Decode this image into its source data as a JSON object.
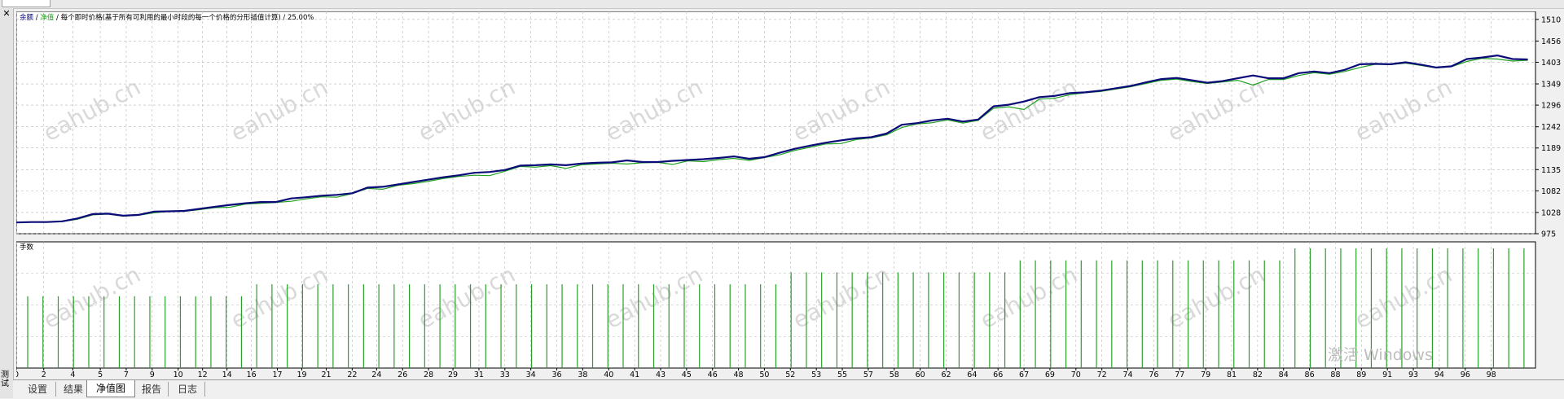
{
  "side": {
    "label": "测试"
  },
  "tabs": [
    {
      "label": "设置",
      "active": false
    },
    {
      "label": "结果",
      "active": false
    },
    {
      "label": "净值图",
      "active": true
    },
    {
      "label": "报告",
      "active": false
    },
    {
      "label": "日志",
      "active": false
    }
  ],
  "watermark": "eahub.cn",
  "os_watermark": "激活 Windows",
  "colors": {
    "balance": "#0a0a78",
    "equity": "#20a020",
    "volume": "#2aa02a",
    "grid": "#b8b8b8",
    "plot_bg": "#ffffff"
  },
  "chart_data": [
    {
      "type": "line",
      "legend": [
        "余额",
        "净值",
        "每个即时价格(基于所有可利用的最小时段的每一个价格的分形插值计算)",
        "25.00%"
      ],
      "legend_placement": "top-left",
      "ylim": [
        975,
        1530
      ],
      "yticks": [
        975,
        1028,
        1082,
        1135,
        1189,
        1242,
        1296,
        1349,
        1403,
        1456,
        1510
      ],
      "xlim": [
        0,
        99.5
      ],
      "xticks": [
        {
          "x": 0,
          "label": "0"
        },
        {
          "x": 1.8,
          "label": "2"
        },
        {
          "x": 3.7,
          "label": "4"
        },
        {
          "x": 5.5,
          "label": "5"
        },
        {
          "x": 7.2,
          "label": "7"
        },
        {
          "x": 8.9,
          "label": "9"
        },
        {
          "x": 10.6,
          "label": "10"
        },
        {
          "x": 12.2,
          "label": "12"
        },
        {
          "x": 13.8,
          "label": "14"
        },
        {
          "x": 15.4,
          "label": "16"
        },
        {
          "x": 17.1,
          "label": "17"
        },
        {
          "x": 18.7,
          "label": "19"
        },
        {
          "x": 20.3,
          "label": "21"
        },
        {
          "x": 22,
          "label": "22"
        },
        {
          "x": 23.6,
          "label": "24"
        },
        {
          "x": 25.3,
          "label": "26"
        },
        {
          "x": 27,
          "label": "28"
        },
        {
          "x": 28.6,
          "label": "29"
        },
        {
          "x": 30.3,
          "label": "31"
        },
        {
          "x": 32,
          "label": "33"
        },
        {
          "x": 33.7,
          "label": "34"
        },
        {
          "x": 35.4,
          "label": "36"
        },
        {
          "x": 37.1,
          "label": "38"
        },
        {
          "x": 38.8,
          "label": "40"
        },
        {
          "x": 40.5,
          "label": "41"
        },
        {
          "x": 42.2,
          "label": "43"
        },
        {
          "x": 43.9,
          "label": "45"
        },
        {
          "x": 45.6,
          "label": "46"
        },
        {
          "x": 47.3,
          "label": "48"
        },
        {
          "x": 49,
          "label": "50"
        },
        {
          "x": 50.7,
          "label": "52"
        },
        {
          "x": 52.4,
          "label": "53"
        },
        {
          "x": 54.1,
          "label": "55"
        },
        {
          "x": 55.8,
          "label": "57"
        },
        {
          "x": 57.5,
          "label": "58"
        },
        {
          "x": 59.2,
          "label": "60"
        },
        {
          "x": 60.9,
          "label": "62"
        },
        {
          "x": 62.6,
          "label": "64"
        },
        {
          "x": 64.3,
          "label": "66"
        },
        {
          "x": 66,
          "label": "67"
        },
        {
          "x": 67.7,
          "label": "69"
        },
        {
          "x": 69.4,
          "label": "70"
        },
        {
          "x": 71.1,
          "label": "72"
        },
        {
          "x": 72.8,
          "label": "74"
        },
        {
          "x": 74.5,
          "label": "76"
        },
        {
          "x": 76.2,
          "label": "77"
        },
        {
          "x": 77.9,
          "label": "79"
        },
        {
          "x": 79.6,
          "label": "81"
        },
        {
          "x": 81.3,
          "label": "82"
        },
        {
          "x": 83,
          "label": "84"
        },
        {
          "x": 84.7,
          "label": "86"
        },
        {
          "x": 86.4,
          "label": "88"
        },
        {
          "x": 88.1,
          "label": "89"
        },
        {
          "x": 89.8,
          "label": "91"
        },
        {
          "x": 91.5,
          "label": "93"
        },
        {
          "x": 93.2,
          "label": "94"
        },
        {
          "x": 94.9,
          "label": "96"
        },
        {
          "x": 96.6,
          "label": "98"
        }
      ],
      "grid": true,
      "series": [
        {
          "name": "余额",
          "x": [
            0,
            1,
            2,
            3,
            4,
            5,
            6,
            7,
            8,
            9,
            10,
            11,
            12,
            13,
            14,
            15,
            16,
            17,
            18,
            19,
            20,
            21,
            22,
            23,
            24,
            25,
            26,
            27,
            28,
            29,
            30,
            31,
            32,
            33,
            34,
            35,
            36,
            37,
            38,
            39,
            40,
            41,
            42,
            43,
            44,
            45,
            46,
            47,
            48,
            49,
            50,
            51,
            52,
            53,
            54,
            55,
            56,
            57,
            58,
            59,
            60,
            61,
            62,
            63,
            64,
            65,
            66,
            67,
            68,
            69,
            70,
            71,
            72,
            73,
            74,
            75,
            76,
            77,
            78,
            79,
            80,
            81,
            82,
            83,
            84,
            85,
            86,
            87,
            88,
            89,
            90,
            91,
            92,
            93,
            94,
            95,
            96,
            97,
            98,
            99
          ],
          "y": [
            1003,
            1004,
            1004,
            1006,
            1013,
            1024,
            1025,
            1020,
            1022,
            1030,
            1031,
            1032,
            1037,
            1042,
            1047,
            1051,
            1054,
            1054,
            1063,
            1066,
            1070,
            1072,
            1076,
            1090,
            1092,
            1098,
            1104,
            1110,
            1116,
            1121,
            1127,
            1129,
            1134,
            1145,
            1146,
            1148,
            1146,
            1150,
            1152,
            1153,
            1158,
            1154,
            1154,
            1157,
            1159,
            1161,
            1164,
            1168,
            1162,
            1166,
            1177,
            1187,
            1195,
            1202,
            1208,
            1213,
            1216,
            1225,
            1247,
            1251,
            1258,
            1262,
            1255,
            1260,
            1293,
            1297,
            1305,
            1316,
            1319,
            1326,
            1328,
            1332,
            1338,
            1344,
            1353,
            1361,
            1364,
            1358,
            1352,
            1356,
            1363,
            1370,
            1363,
            1363,
            1376,
            1380,
            1376,
            1384,
            1398,
            1399,
            1398,
            1403,
            1397,
            1390,
            1393,
            1411,
            1415,
            1420,
            1411,
            1410
          ]
        },
        {
          "name": "净值",
          "x": [
            0,
            1,
            2,
            3,
            4,
            5,
            6,
            7,
            8,
            9,
            10,
            11,
            12,
            13,
            14,
            15,
            16,
            17,
            18,
            19,
            20,
            21,
            22,
            23,
            24,
            25,
            26,
            27,
            28,
            29,
            30,
            31,
            32,
            33,
            34,
            35,
            36,
            37,
            38,
            39,
            40,
            41,
            42,
            43,
            44,
            45,
            46,
            47,
            48,
            49,
            50,
            51,
            52,
            53,
            54,
            55,
            56,
            57,
            58,
            59,
            60,
            61,
            62,
            63,
            64,
            65,
            66,
            67,
            68,
            69,
            70,
            71,
            72,
            73,
            74,
            75,
            76,
            77,
            78,
            79,
            80,
            81,
            82,
            83,
            84,
            85,
            86,
            87,
            88,
            89,
            90,
            91,
            92,
            93,
            94,
            95,
            96,
            97,
            98,
            99
          ],
          "y": [
            1003,
            1004,
            1004,
            1005,
            1011,
            1022,
            1024,
            1019,
            1021,
            1027,
            1031,
            1031,
            1035,
            1040,
            1041,
            1049,
            1051,
            1053,
            1056,
            1062,
            1067,
            1066,
            1075,
            1088,
            1086,
            1096,
            1100,
            1106,
            1113,
            1118,
            1121,
            1120,
            1131,
            1143,
            1141,
            1145,
            1138,
            1147,
            1149,
            1151,
            1149,
            1152,
            1153,
            1148,
            1157,
            1155,
            1160,
            1163,
            1158,
            1165,
            1172,
            1183,
            1191,
            1199,
            1200,
            1210,
            1214,
            1222,
            1240,
            1249,
            1252,
            1259,
            1251,
            1258,
            1288,
            1292,
            1285,
            1311,
            1313,
            1322,
            1327,
            1330,
            1336,
            1342,
            1350,
            1358,
            1361,
            1355,
            1350,
            1354,
            1358,
            1346,
            1360,
            1360,
            1370,
            1377,
            1373,
            1380,
            1390,
            1398,
            1397,
            1401,
            1395,
            1389,
            1392,
            1405,
            1413,
            1411,
            1406,
            1408
          ]
        }
      ]
    },
    {
      "type": "bar",
      "legend": [
        "手数"
      ],
      "ylim": [
        0,
        0.1
      ],
      "x": [
        0,
        1,
        2,
        3,
        4,
        5,
        6,
        7,
        8,
        9,
        10,
        11,
        12,
        13,
        14,
        15,
        16,
        17,
        18,
        19,
        20,
        21,
        22,
        23,
        24,
        25,
        26,
        27,
        28,
        29,
        30,
        31,
        32,
        33,
        34,
        35,
        36,
        37,
        38,
        39,
        40,
        41,
        42,
        43,
        44,
        45,
        46,
        47,
        48,
        49,
        50,
        51,
        52,
        53,
        54,
        55,
        56,
        57,
        58,
        59,
        60,
        61,
        62,
        63,
        64,
        65,
        66,
        67,
        68,
        69,
        70,
        71,
        72,
        73,
        74,
        75,
        76,
        77,
        78,
        79,
        80,
        81,
        82,
        83,
        84,
        85,
        86,
        87,
        88,
        89,
        90,
        91,
        92,
        93,
        94,
        95,
        96,
        97,
        98,
        99
      ],
      "values": [
        0.06,
        0.06,
        0.06,
        0.06,
        0.06,
        0.06,
        0.06,
        0.06,
        0.06,
        0.06,
        0.06,
        0.06,
        0.06,
        0.06,
        0.06,
        0.07,
        0.07,
        0.07,
        0.07,
        0.07,
        0.07,
        0.07,
        0.07,
        0.07,
        0.07,
        0.07,
        0.07,
        0.07,
        0.07,
        0.07,
        0.07,
        0.07,
        0.07,
        0.07,
        0.07,
        0.07,
        0.07,
        0.07,
        0.07,
        0.07,
        0.07,
        0.07,
        0.07,
        0.07,
        0.07,
        0.07,
        0.07,
        0.07,
        0.07,
        0.07,
        0.08,
        0.08,
        0.08,
        0.08,
        0.08,
        0.08,
        0.08,
        0.08,
        0.08,
        0.08,
        0.08,
        0.08,
        0.08,
        0.08,
        0.08,
        0.09,
        0.09,
        0.09,
        0.09,
        0.09,
        0.09,
        0.09,
        0.09,
        0.09,
        0.09,
        0.09,
        0.09,
        0.09,
        0.09,
        0.09,
        0.09,
        0.09,
        0.09,
        0.1,
        0.1,
        0.1,
        0.1,
        0.1,
        0.1,
        0.1,
        0.1,
        0.1,
        0.1,
        0.1,
        0.1,
        0.1,
        0.1,
        0.1,
        0.1,
        0.1
      ]
    }
  ]
}
